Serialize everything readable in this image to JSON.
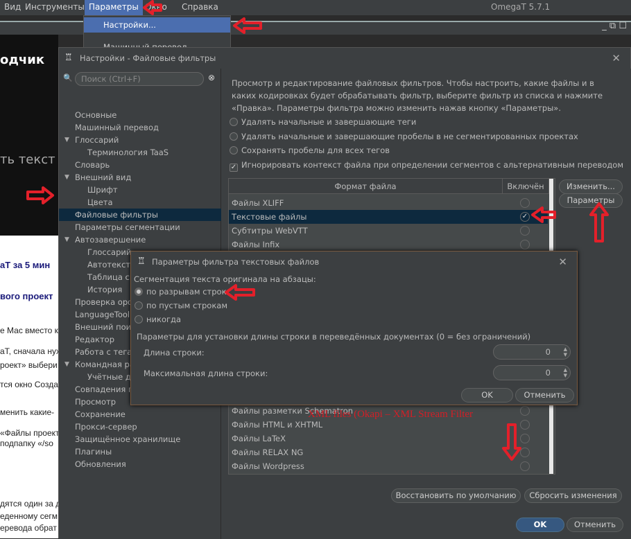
{
  "menubar": {
    "items": [
      "Вид",
      "Инструменты",
      "Параметры",
      "Окно",
      "Справка"
    ],
    "app_title": "OmegaT 5.7.1"
  },
  "dropdown": {
    "items": [
      "Настройки...",
      "Машинный перевод"
    ]
  },
  "background": {
    "heading": "одчик",
    "heading2": "т",
    "subtitle": "ть текст",
    "doc_lines": [
      "аТ за 5 мин",
      "вого проект",
      "е Мас вместо к",
      "аТ, сначала нуж",
      "роект» выбери",
      "тся окно Созда",
      "менить какие-",
      "«Файлы проект",
      "подпапку «/so",
      "дятся один за д",
      "еденному сегм",
      "еревода обрат"
    ]
  },
  "settings_dialog": {
    "title": "Настройки - Файловые фильтры",
    "search_placeholder": "Поиск (Ctrl+F)",
    "tree": [
      {
        "label": "Основные",
        "level": 0
      },
      {
        "label": "Машинный перевод",
        "level": 0
      },
      {
        "label": "Глоссарий",
        "level": 0,
        "expanded": true
      },
      {
        "label": "Терминология TaaS",
        "level": 1
      },
      {
        "label": "Словарь",
        "level": 0
      },
      {
        "label": "Внешний вид",
        "level": 0,
        "expanded": true
      },
      {
        "label": "Шрифт",
        "level": 1
      },
      {
        "label": "Цвета",
        "level": 1
      },
      {
        "label": "Файловые фильтры",
        "level": 0,
        "selected": true
      },
      {
        "label": "Параметры сегментации",
        "level": 0
      },
      {
        "label": "Автозавершение",
        "level": 0,
        "expanded": true
      },
      {
        "label": "Глоссарий",
        "level": 1
      },
      {
        "label": "Автотекст",
        "level": 1
      },
      {
        "label": "Таблица символов",
        "level": 1
      },
      {
        "label": "История",
        "level": 1
      },
      {
        "label": "Проверка орфографии",
        "level": 0
      },
      {
        "label": "LanguageTool",
        "level": 0
      },
      {
        "label": "Внешний поиск",
        "level": 0
      },
      {
        "label": "Редактор",
        "level": 0
      },
      {
        "label": "Работа с тегами",
        "level": 0
      },
      {
        "label": "Командная работа",
        "level": 0,
        "expanded": true
      },
      {
        "label": "Учётные данные",
        "level": 1
      },
      {
        "label": "Совпадения памяти",
        "level": 0
      },
      {
        "label": "Просмотр",
        "level": 0
      },
      {
        "label": "Сохранение",
        "level": 0
      },
      {
        "label": "Прокси-сервер",
        "level": 0
      },
      {
        "label": "Защищённое хранилище",
        "level": 0
      },
      {
        "label": "Плагины",
        "level": 0
      },
      {
        "label": "Обновления",
        "level": 0
      }
    ],
    "description": "Просмотр и редактирование файловых фильтров. Чтобы настроить, какие файлы и в каких кодировках будет обрабатывать фильтр, выберите фильтр из списка и нажмите «Правка». Параметры фильтра можно изменить нажав кнопку «Параметры».",
    "options": [
      {
        "label": "Удалять начальные и завершающие теги",
        "checked": false
      },
      {
        "label": "Удалять начальные и завершающие пробелы в не сегментированных проектах",
        "checked": false
      },
      {
        "label": "Сохранять пробелы для всех тегов",
        "checked": false
      },
      {
        "label": "Игнорировать контекст файла при определении сегментов с альтернативным переводом",
        "checked": true
      }
    ],
    "table": {
      "headers": [
        "Формат файла",
        "Включён"
      ],
      "rows_top": [
        {
          "name": "Файлы XLIFF",
          "enabled": false
        },
        {
          "name": "Текстовые файлы",
          "enabled": true,
          "selected": true
        },
        {
          "name": "Субтитры WebVTT",
          "enabled": false
        },
        {
          "name": "Файлы Infix",
          "enabled": false
        }
      ],
      "rows_bottom": [
        {
          "name": "Файлы разметки Schematron",
          "enabled": false
        },
        {
          "name": "Файлы HTML и XHTML",
          "enabled": false
        },
        {
          "name": "Файлы LaTeX",
          "enabled": false
        },
        {
          "name": "Файлы RELAX NG",
          "enabled": false
        },
        {
          "name": "Файлы Wordpress",
          "enabled": false
        }
      ]
    },
    "buttons": {
      "edit": "Изменить...",
      "params": "Параметры",
      "restore": "Восстановить по умолчанию",
      "reset": "Сбросить изменения",
      "ok": "OK",
      "cancel": "Отменить"
    }
  },
  "filter_dialog": {
    "title": "Параметры фильтра текстовых файлов",
    "segmentation_label": "Сегментация текста оригинала на абзацы:",
    "radios": [
      {
        "label": "по разрывам строк",
        "selected": true
      },
      {
        "label": "по пустым строкам",
        "selected": false
      },
      {
        "label": "никогда",
        "selected": false
      }
    ],
    "line_length_label": "Параметры для установки длины строки в переведённых документах (0 = без ограничений)",
    "line_length": {
      "label": "Длина строки:",
      "value": "0"
    },
    "max_line_length": {
      "label": "Максимальная длина строки:",
      "value": "0"
    },
    "ok": "OK",
    "cancel": "Отменить"
  },
  "annotation": {
    "text": "XML files (Okapi – XML Stream Filter",
    "color": "#d41e26"
  },
  "colors": {
    "accent": "#4b6eaf",
    "selection": "#0d293e",
    "arrow": "#e3202a"
  }
}
